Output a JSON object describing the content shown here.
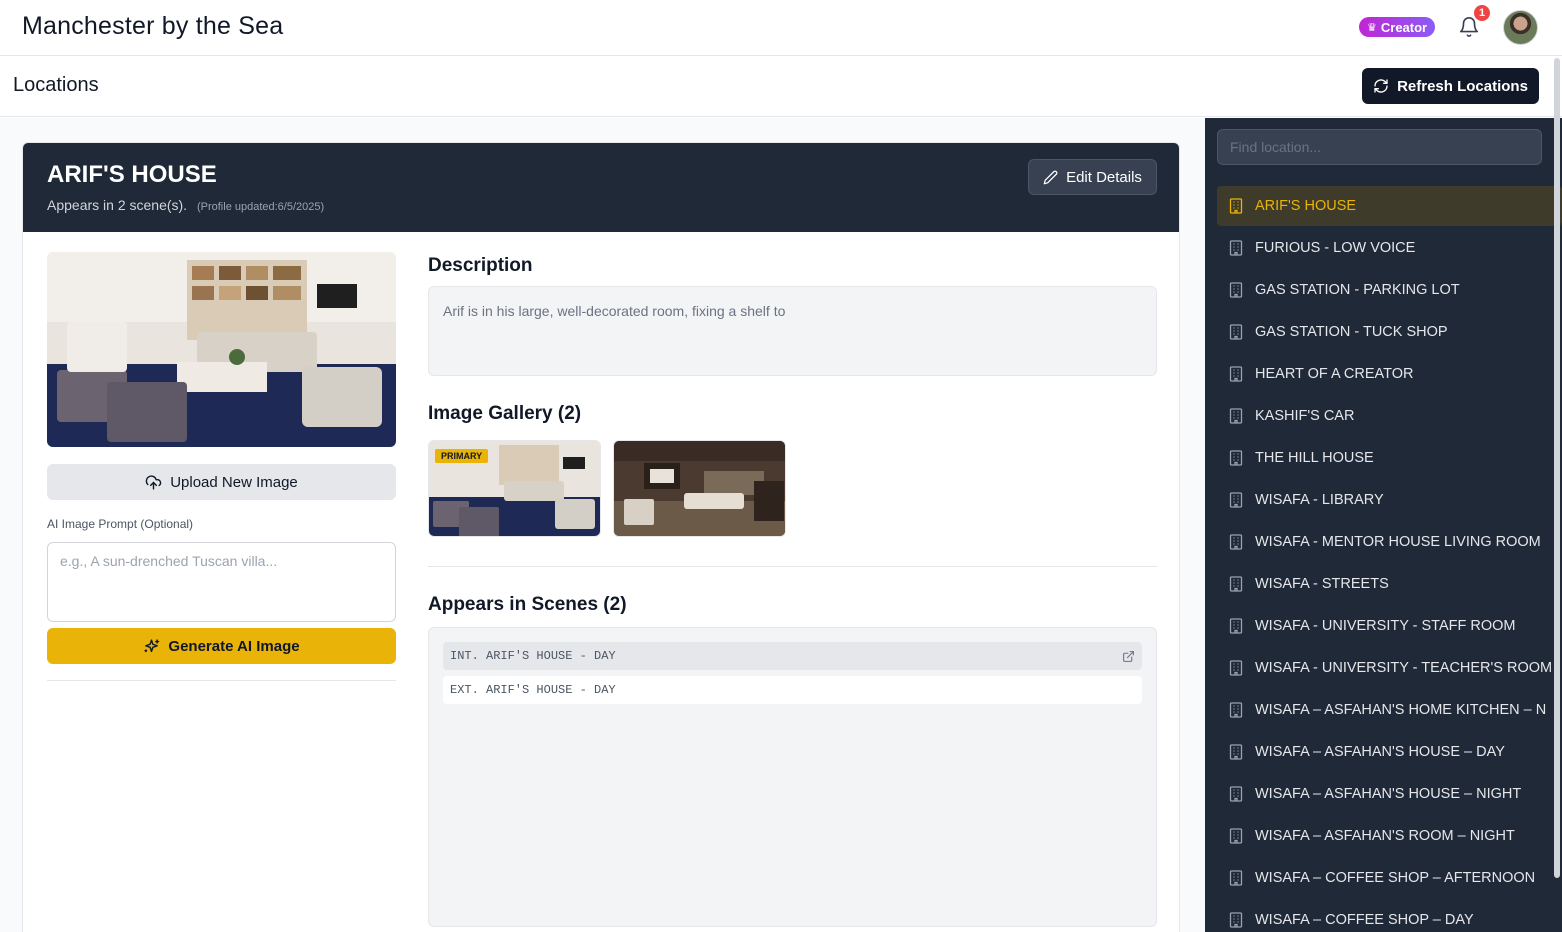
{
  "app": {
    "title": "Manchester by the Sea"
  },
  "header": {
    "creator_badge": "Creator",
    "notification_count": "1"
  },
  "page": {
    "title": "Locations",
    "refresh_label": "Refresh Locations"
  },
  "location": {
    "name": "ARIF'S HOUSE",
    "appears_text": "Appears in 2 scene(s).",
    "profile_updated": "(Profile updated:6/5/2025)",
    "edit_label": "Edit Details",
    "upload_label": "Upload New Image",
    "prompt_label": "AI Image Prompt (Optional)",
    "prompt_placeholder": "e.g., A sun-drenched Tuscan villa...",
    "prompt_value": "",
    "generate_label": "Generate AI Image",
    "description_title": "Description",
    "description": "Arif is in his large, well-decorated room, fixing a shelf to",
    "gallery_title": "Image Gallery (2)",
    "primary_tag": "PRIMARY",
    "scenes_title": "Appears in Scenes (2)",
    "scenes": [
      "INT. ARIF'S HOUSE - DAY",
      "EXT. ARIF'S HOUSE - DAY"
    ]
  },
  "sidebar": {
    "search_placeholder": "Find location...",
    "items": [
      "ARIF'S HOUSE",
      "FURIOUS - LOW VOICE",
      "GAS STATION - PARKING LOT",
      "GAS STATION - TUCK SHOP",
      "HEART OF A CREATOR",
      "KASHIF'S CAR",
      "THE HILL HOUSE",
      "WISAFA - LIBRARY",
      "WISAFA - MENTOR HOUSE LIVING ROOM",
      "WISAFA - STREETS",
      "WISAFA - UNIVERSITY - STAFF ROOM",
      "WISAFA - UNIVERSITY - TEACHER'S ROOM",
      "WISAFA – ASFAHAN'S HOME KITCHEN – N",
      "WISAFA – ASFAHAN'S HOUSE – DAY",
      "WISAFA – ASFAHAN'S HOUSE – NIGHT",
      "WISAFA – ASFAHAN'S ROOM – NIGHT",
      "WISAFA – COFFEE SHOP – AFTERNOON",
      "WISAFA – COFFEE SHOP – DAY"
    ],
    "active_index": 0
  },
  "colors": {
    "accent": "#eab308",
    "dark": "#1f2937",
    "badge": "#c026d3",
    "alert": "#ef4444"
  },
  "icons": [
    "crown-icon",
    "bell-icon",
    "refresh-icon",
    "pencil-icon",
    "cloud-upload-icon",
    "sparkles-icon",
    "external-link-icon",
    "building-icon"
  ]
}
